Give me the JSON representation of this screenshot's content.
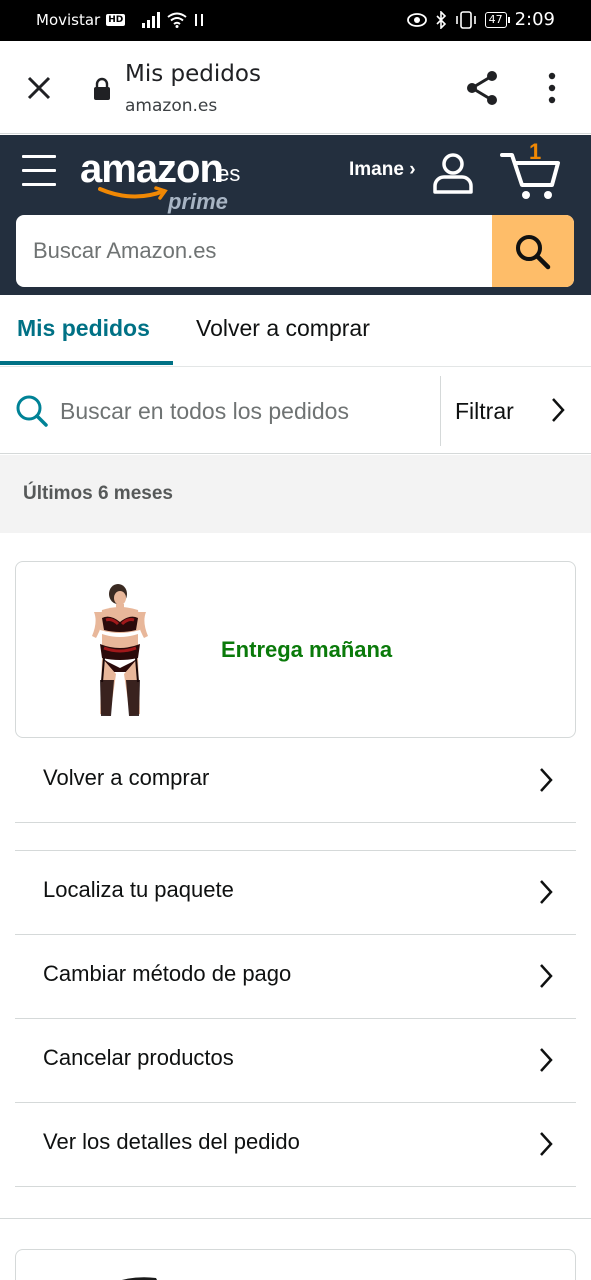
{
  "status_bar": {
    "carrier": "Movistar",
    "network_badge": "HD",
    "battery": "47",
    "time": "2:09"
  },
  "browser": {
    "title": "Mis pedidos",
    "url": "amazon.es"
  },
  "header": {
    "logo_text": "amazon",
    "logo_suffix": ".es",
    "logo_prime": "prime",
    "account_name": "Imane ›",
    "cart_count": "1",
    "search_placeholder": "Buscar Amazon.es"
  },
  "tabs": [
    {
      "label": "Mis pedidos",
      "active": true
    },
    {
      "label": "Volver a comprar",
      "active": false
    }
  ],
  "order_search": {
    "placeholder": "Buscar en todos los pedidos",
    "filter_label": "Filtrar"
  },
  "period_label": "Últimos 6 meses",
  "order": {
    "delivery_status": "Entrega mañana"
  },
  "actions": [
    {
      "label": "Volver a comprar"
    },
    {
      "label": "Localiza tu paquete"
    },
    {
      "label": "Cambiar método de pago"
    },
    {
      "label": "Cancelar productos"
    },
    {
      "label": "Ver los detalles del pedido"
    }
  ],
  "colors": {
    "header_bg": "#232f3e",
    "search_button": "#febd69",
    "accent_teal": "#007185",
    "cart_orange": "#f08804",
    "delivery_green": "#0a7a0a"
  }
}
